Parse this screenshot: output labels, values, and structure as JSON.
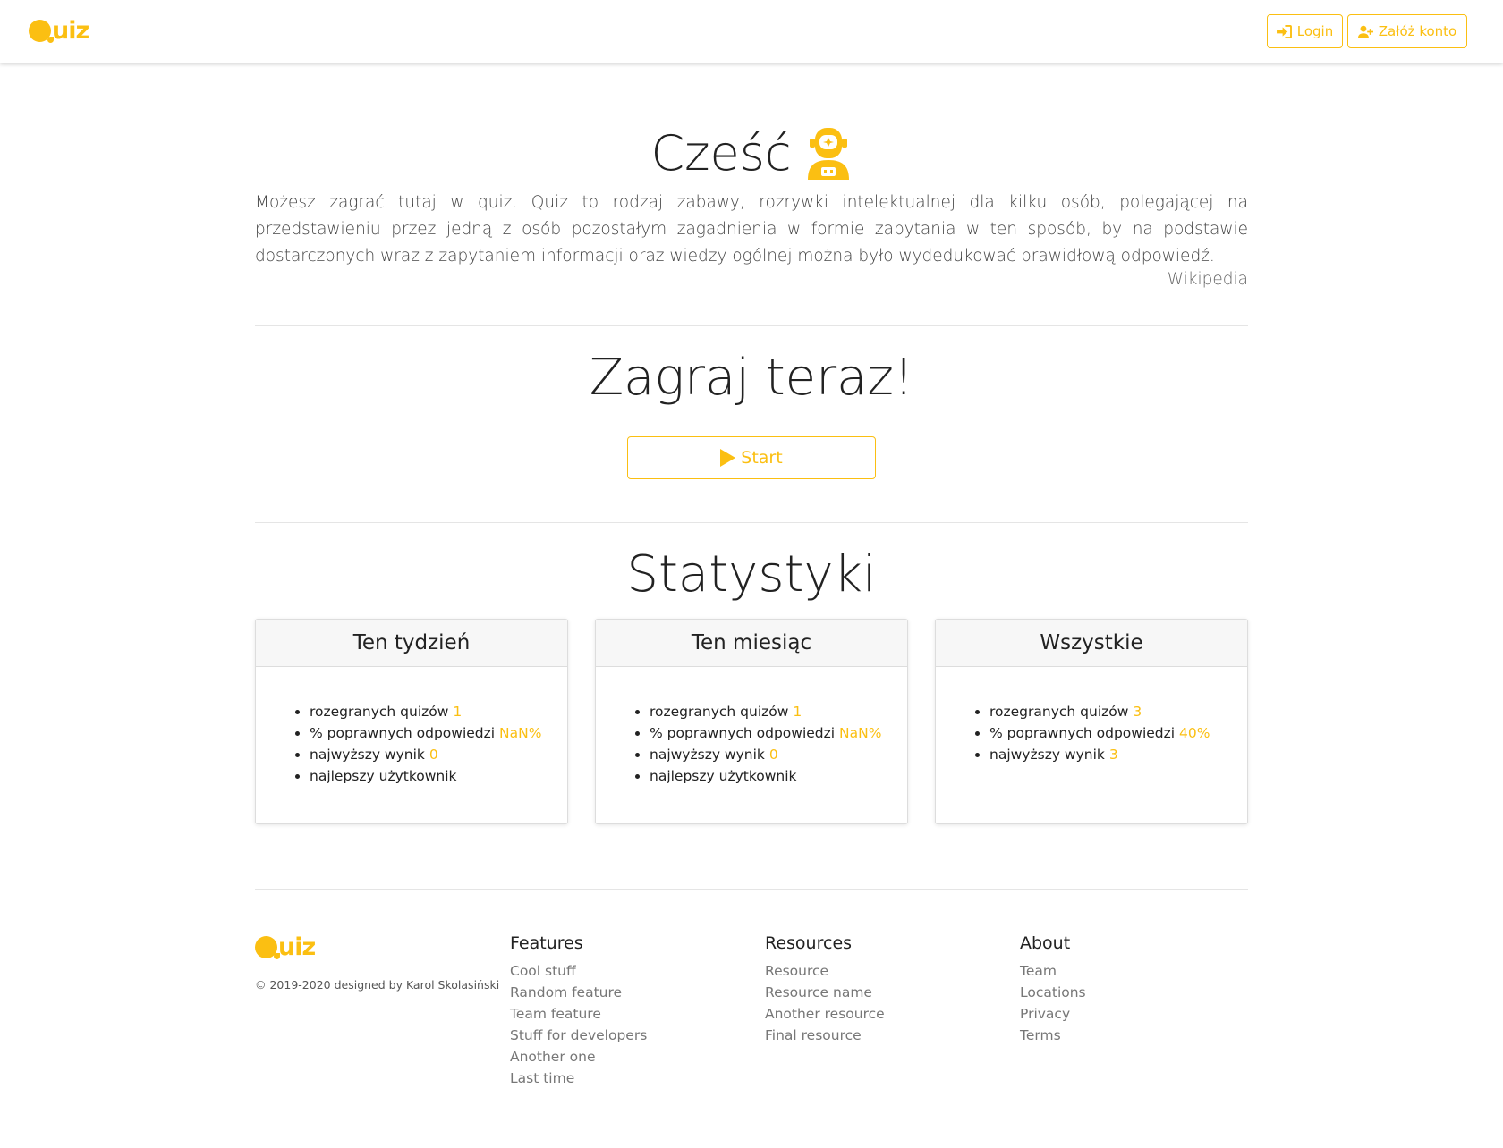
{
  "brand": {
    "logo_text": "uiz",
    "logo_word": "Quiz"
  },
  "nav": {
    "login_label": "Login",
    "register_label": "Załóż konto"
  },
  "hero": {
    "title": "Cześć",
    "intro": "Możesz zagrać tutaj w quiz. Quiz to rodzaj zabawy, rozrywki intelektualnej dla kilku osób, polegającej na przedstawieniu przez jedną z osób pozostałym zagadnienia w formie zapytania w ten sposób, by na podstawie dostarczonych wraz z zapytaniem informacji oraz wiedzy ogólnej można było wydedukować prawidłową odpowiedź.",
    "source": "Wikipedia"
  },
  "play": {
    "title": "Zagraj teraz!",
    "start_label": "Start"
  },
  "stats": {
    "title": "Statystyki",
    "cards": [
      {
        "header": "Ten tydzień",
        "items": [
          {
            "label": "rozegranych quizów",
            "value": "1"
          },
          {
            "label": "% poprawnych odpowiedzi",
            "value": "NaN%"
          },
          {
            "label": "najwyższy wynik",
            "value": "0"
          },
          {
            "label": "najlepszy użytkownik",
            "value": ""
          }
        ]
      },
      {
        "header": "Ten miesiąc",
        "items": [
          {
            "label": "rozegranych quizów",
            "value": "1"
          },
          {
            "label": "% poprawnych odpowiedzi",
            "value": "NaN%"
          },
          {
            "label": "najwyższy wynik",
            "value": "0"
          },
          {
            "label": "najlepszy użytkownik",
            "value": ""
          }
        ]
      },
      {
        "header": "Wszystkie",
        "items": [
          {
            "label": "rozegranych quizów",
            "value": "3"
          },
          {
            "label": "% poprawnych odpowiedzi",
            "value": "40%"
          },
          {
            "label": "najwyższy wynik",
            "value": "3"
          }
        ]
      }
    ]
  },
  "footer": {
    "copyright": "© 2019-2020 designed by Karol Skolasiński",
    "columns": [
      {
        "title": "Features",
        "links": [
          "Cool stuff",
          "Random feature",
          "Team feature",
          "Stuff for developers",
          "Another one",
          "Last time"
        ]
      },
      {
        "title": "Resources",
        "links": [
          "Resource",
          "Resource name",
          "Another resource",
          "Final resource"
        ]
      },
      {
        "title": "About",
        "links": [
          "Team",
          "Locations",
          "Privacy",
          "Terms"
        ]
      }
    ]
  },
  "colors": {
    "accent": "#fbbf12"
  }
}
